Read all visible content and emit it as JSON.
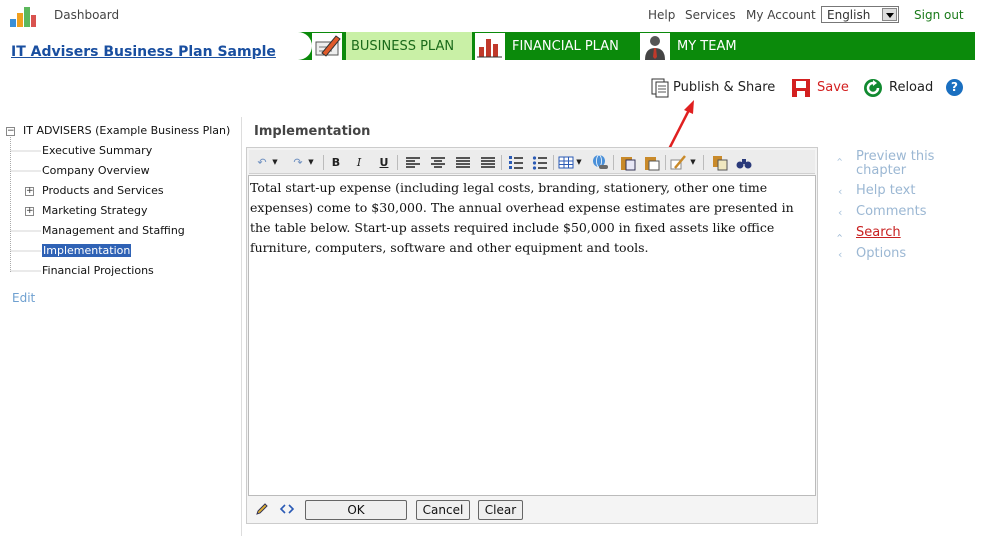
{
  "topbar": {
    "dashboard_label": "Dashboard",
    "help_label": "Help",
    "services_label": "Services",
    "account_label": "My Account",
    "language_value": "English",
    "signout_label": "Sign out"
  },
  "plan_title": "IT Advisers Business Plan Sample",
  "nav": {
    "tabs": [
      {
        "label": "BUSINESS PLAN",
        "icon": "pencil-paper-icon"
      },
      {
        "label": "FINANCIAL PLAN",
        "icon": "bar-chart-icon"
      },
      {
        "label": "MY TEAM",
        "icon": "person-icon"
      }
    ],
    "active_color": "#c9f0a6",
    "bar_color": "#0b8a0b"
  },
  "actions": {
    "publish_label": "Publish & Share",
    "save_label": "Save",
    "reload_label": "Reload",
    "help_glyph": "?"
  },
  "tree": {
    "root_label": "IT ADVISERS (Example Business Plan)",
    "items": [
      {
        "label": "Executive Summary"
      },
      {
        "label": "Company Overview"
      },
      {
        "label": "Products and Services"
      },
      {
        "label": "Marketing Strategy"
      },
      {
        "label": "Management and Staffing"
      },
      {
        "label": "Implementation"
      },
      {
        "label": "Financial Projections"
      }
    ],
    "expander_glyph": "+",
    "root_expander_glyph": "−",
    "edit_label": "Edit"
  },
  "content": {
    "chapter_title": "Implementation",
    "body_text": "Total start-up expense (including legal costs, branding, stationery, other one time expenses) come to $30,000. The annual overhead expense estimates are presented in the table below. Start-up assets required include $50,000 in fixed assets like office furniture, computers, software and other equipment and tools."
  },
  "toolbar": {
    "bold": "B",
    "italic": "I",
    "underline": "U"
  },
  "buttons": {
    "ok_label": "OK",
    "cancel_label": "Cancel",
    "clear_label": "Clear"
  },
  "right_panel": {
    "items": [
      {
        "label": "Preview this chapter"
      },
      {
        "label": "Help text"
      },
      {
        "label": "Comments"
      },
      {
        "label": "Search"
      },
      {
        "label": "Options"
      }
    ],
    "chevron": "‹"
  }
}
